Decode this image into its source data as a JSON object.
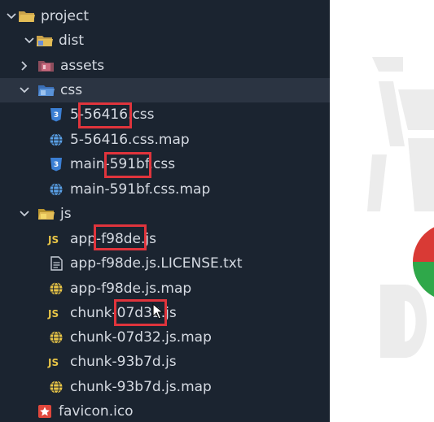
{
  "explorer": {
    "tree": [
      {
        "label": "project",
        "type": "folder",
        "open": true
      },
      {
        "label": "dist",
        "type": "folder-dist",
        "open": true
      },
      {
        "label": "assets",
        "type": "folder-assets",
        "open": false
      },
      {
        "label": "css",
        "type": "folder-css",
        "open": true
      },
      {
        "label_pre": "5-",
        "label_hl": "56416",
        "label_post": ".css",
        "type": "css-file"
      },
      {
        "label": "5-56416.css.map",
        "type": "map-file"
      },
      {
        "label_pre": "main-",
        "label_hl": "591bf",
        "label_post": ".css",
        "type": "css-file"
      },
      {
        "label": "main-591bf.css.map",
        "type": "map-file"
      },
      {
        "label": "js",
        "type": "folder-js",
        "open": true
      },
      {
        "label_pre": "app-",
        "label_hl": "f98de",
        "label_post": ".js",
        "type": "js-file"
      },
      {
        "label": "app-f98de.js.LICENSE.txt",
        "type": "txt-file"
      },
      {
        "label": "app-f98de.js.map",
        "type": "map-file"
      },
      {
        "label_pre": "chunk-",
        "label_hl": "07d32",
        "label_post": ".js",
        "type": "js-file"
      },
      {
        "label": "chunk-07d32.js.map",
        "type": "map-file"
      },
      {
        "label": "chunk-93b7d.js",
        "type": "js-file"
      },
      {
        "label": "chunk-93b7d.js.map",
        "type": "map-file"
      },
      {
        "label": "favicon.ico",
        "type": "ico-file"
      }
    ]
  },
  "colors": {
    "sidebar_bg": "#1b2430",
    "highlight_box": "#e0343c",
    "js_icon": "#e8c547",
    "css_icon": "#5aa0e6",
    "folder": "#d8b24a"
  },
  "icons": {
    "folder": "folder-icon",
    "css": "css3-icon",
    "map": "globe-map-icon",
    "js": "js-icon",
    "txt": "text-file-icon",
    "ico": "star-image-icon"
  }
}
